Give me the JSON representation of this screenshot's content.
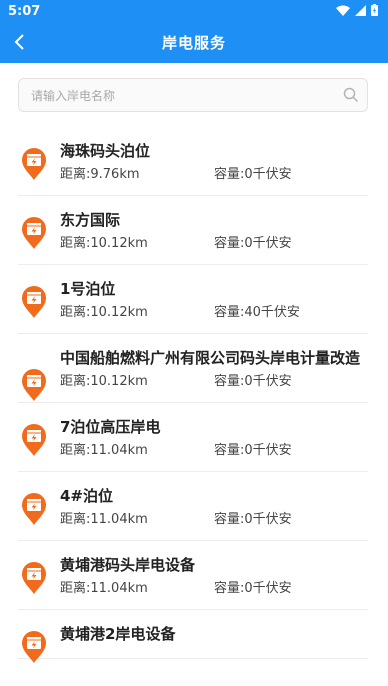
{
  "status": {
    "time": "5:07"
  },
  "header": {
    "title": "岸电服务"
  },
  "search": {
    "placeholder": "请输入岸电名称",
    "value": ""
  },
  "list": {
    "items": [
      {
        "name": "海珠码头泊位",
        "distance": "距离:9.76km",
        "capacity": "容量:0千伏安"
      },
      {
        "name": "东方国际",
        "distance": "距离:10.12km",
        "capacity": "容量:0千伏安"
      },
      {
        "name": "1号泊位",
        "distance": "距离:10.12km",
        "capacity": "容量:40千伏安"
      },
      {
        "name": "中国船舶燃料广州有限公司码头岸电计量改造",
        "distance": "距离:10.12km",
        "capacity": "容量:0千伏安"
      },
      {
        "name": "7泊位高压岸电",
        "distance": "距离:11.04km",
        "capacity": "容量:0千伏安"
      },
      {
        "name": "4#泊位",
        "distance": "距离:11.04km",
        "capacity": "容量:0千伏安"
      },
      {
        "name": "黄埔港码头岸电设备",
        "distance": "距离:11.04km",
        "capacity": "容量:0千伏安"
      },
      {
        "name": "黄埔港2岸电设备",
        "distance": "",
        "capacity": ""
      }
    ]
  },
  "colors": {
    "header": "#1e8ff5",
    "pin": "#f26a1b"
  },
  "icons": {
    "back": "chevron-left-icon",
    "search": "search-icon",
    "pin": "charging-pin-icon"
  }
}
